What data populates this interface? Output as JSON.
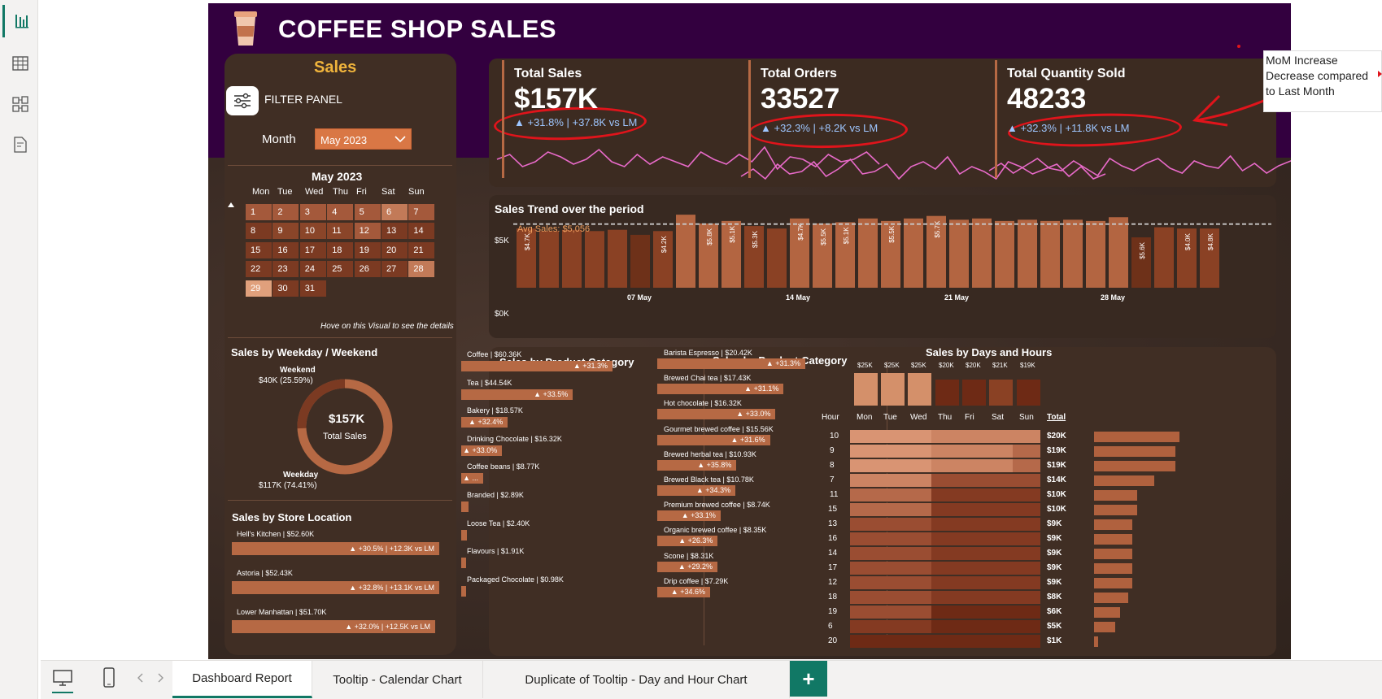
{
  "header": {
    "title": "COFFEE SHOP SALES"
  },
  "filter": {
    "section_title": "Sales",
    "panel_label": "FILTER PANEL",
    "month_label": "Month",
    "month_value": "May 2023",
    "calendar_title": "May 2023",
    "weekdays": [
      "Mon",
      "Tue",
      "Wed",
      "Thu",
      "Fri",
      "Sat",
      "Sun"
    ],
    "days": [
      "1",
      "2",
      "3",
      "4",
      "5",
      "6",
      "7",
      "8",
      "9",
      "10",
      "11",
      "12",
      "13",
      "14",
      "15",
      "16",
      "17",
      "18",
      "19",
      "20",
      "21",
      "22",
      "23",
      "24",
      "25",
      "26",
      "27",
      "28",
      "29",
      "30",
      "31"
    ],
    "hint": "Hove on this Visual to see the details"
  },
  "weekday": {
    "title": "Sales by Weekday / Weekend",
    "weekend_label": "Weekend",
    "weekend_value": "$40K (25.59%)",
    "weekday_label": "Weekday",
    "weekday_value": "$117K (74.41%)",
    "center_value": "$157K",
    "center_label": "Total Sales"
  },
  "store": {
    "title": "Sales by Store Location",
    "items": [
      {
        "label": "Hell's Kitchen | $52.60K",
        "delta": "▲ +30.5% | +12.3K vs LM"
      },
      {
        "label": "Astoria | $52.43K",
        "delta": "▲ +32.8% | +13.1K vs LM"
      },
      {
        "label": "Lower Manhattan | $51.70K",
        "delta": "▲ +32.0% | +12.5K vs LM"
      }
    ]
  },
  "kpis": [
    {
      "title": "Total Sales",
      "value": "$157K",
      "delta": "▲ +31.8% | +37.8K vs LM"
    },
    {
      "title": "Total Orders",
      "value": "33527",
      "delta": "▲ +32.3% | +8.2K vs LM"
    },
    {
      "title": "Total Quantity Sold",
      "value": "48233",
      "delta": "▲ +32.3% | +11.8K vs LM"
    }
  ],
  "trend": {
    "title": "Sales Trend over the period",
    "avg_label": "Avg Sales: $5,056",
    "ytick_top": "$5K",
    "ytick_bottom": "$0K",
    "xticks": [
      "07 May",
      "14 May",
      "21 May",
      "28 May"
    ],
    "bar_labels": [
      "$4.7K",
      "",
      "",
      "",
      "",
      "",
      "$4.2K",
      "",
      "$5.8K",
      "$5.1K",
      "$5.3K",
      "",
      "$4.7K",
      "$5.5K",
      "$5.1K",
      "",
      "$5.5K",
      "",
      "$5.7K",
      "",
      "",
      "",
      "",
      "",
      "",
      "",
      "",
      "$5.6K",
      "",
      "$4.0K",
      "$4.8K",
      "$4.7K"
    ]
  },
  "cat1": {
    "title": "Sales by Product Category",
    "items": [
      {
        "label": "Coffee | $60.36K",
        "delta": "▲ +31.3%"
      },
      {
        "label": "Tea | $44.54K",
        "delta": "▲ +33.5%"
      },
      {
        "label": "Bakery | $18.57K",
        "delta": "▲ +32.4%"
      },
      {
        "label": "Drinking Chocolate | $16.32K",
        "delta": "▲ +33.0%"
      },
      {
        "label": "Coffee beans | $8.77K",
        "delta": "▲ ..."
      },
      {
        "label": "Branded | $2.89K",
        "delta": ""
      },
      {
        "label": "Loose Tea | $2.40K",
        "delta": ""
      },
      {
        "label": "Flavours | $1.91K",
        "delta": ""
      },
      {
        "label": "Packaged Chocolate | $0.98K",
        "delta": ""
      }
    ]
  },
  "cat2": {
    "title": "Sales by Product Category",
    "items": [
      {
        "label": "Barista Espresso | $20.42K",
        "delta": "▲ +31.3%"
      },
      {
        "label": "Brewed Chai tea | $17.43K",
        "delta": "▲ +31.1%"
      },
      {
        "label": "Hot chocolate | $16.32K",
        "delta": "▲ +33.0%"
      },
      {
        "label": "Gourmet brewed coffee | $15.56K",
        "delta": "▲ +31.6%"
      },
      {
        "label": "Brewed herbal tea | $10.93K",
        "delta": "▲ +35.8%"
      },
      {
        "label": "Brewed Black tea | $10.78K",
        "delta": "▲ +34.3%"
      },
      {
        "label": "Premium brewed coffee | $8.74K",
        "delta": "▲ +33.1%"
      },
      {
        "label": "Organic brewed coffee | $8.35K",
        "delta": "▲ +26.3%"
      },
      {
        "label": "Scone | $8.31K",
        "delta": "▲ +29.2%"
      },
      {
        "label": "Drip coffee | $7.29K",
        "delta": "▲ +34.6%"
      }
    ]
  },
  "heat": {
    "title": "Sales by Days and Hours",
    "day_totals": [
      "$25K",
      "$25K",
      "$25K",
      "$20K",
      "$20K",
      "$21K",
      "$19K"
    ],
    "hour_header": "Hour",
    "days": [
      "Mon",
      "Tue",
      "Wed",
      "Thu",
      "Fri",
      "Sat",
      "Sun"
    ],
    "total_header": "Total",
    "hours": [
      "10",
      "9",
      "8",
      "7",
      "11",
      "15",
      "13",
      "16",
      "14",
      "17",
      "12",
      "18",
      "19",
      "6",
      "20"
    ],
    "totals": [
      "$20K",
      "$19K",
      "$19K",
      "$14K",
      "$10K",
      "$10K",
      "$9K",
      "$9K",
      "$9K",
      "$9K",
      "$9K",
      "$8K",
      "$6K",
      "$5K",
      "$1K"
    ]
  },
  "annotation": {
    "text": "MoM Increase Decrease compared to Last Month"
  },
  "tabs": {
    "items": [
      "Dashboard Report",
      "Tooltip - Calendar Chart",
      "Duplicate of Tooltip - Day and Hour Chart"
    ],
    "add": "+"
  },
  "chart_data": [
    {
      "type": "bar",
      "title": "Sales Trend over the period",
      "categories": [
        "1",
        "2",
        "3",
        "4",
        "5",
        "6",
        "7",
        "8",
        "9",
        "10",
        "11",
        "12",
        "13",
        "14",
        "15",
        "16",
        "17",
        "18",
        "19",
        "20",
        "21",
        "22",
        "23",
        "24",
        "25",
        "26",
        "27",
        "28",
        "29",
        "30",
        "31"
      ],
      "values": [
        4.7,
        4.5,
        4.6,
        4.5,
        4.6,
        4.2,
        4.5,
        5.8,
        5.1,
        5.3,
        4.9,
        4.7,
        5.5,
        5.1,
        5.2,
        5.5,
        5.3,
        5.5,
        5.7,
        5.4,
        5.5,
        5.3,
        5.4,
        5.3,
        5.4,
        5.3,
        5.6,
        4.0,
        4.8,
        4.7,
        4.7
      ],
      "ylim": [
        0,
        6
      ],
      "average": 5.056,
      "ylabel": ""
    },
    {
      "type": "bar",
      "title": "Sales by Product Category",
      "categories": [
        "Coffee",
        "Tea",
        "Bakery",
        "Drinking Chocolate",
        "Coffee beans",
        "Branded",
        "Loose Tea",
        "Flavours",
        "Packaged Chocolate"
      ],
      "values": [
        60.36,
        44.54,
        18.57,
        16.32,
        8.77,
        2.89,
        2.4,
        1.91,
        0.98
      ]
    },
    {
      "type": "bar",
      "title": "Sales by Product Category",
      "categories": [
        "Barista Espresso",
        "Brewed Chai tea",
        "Hot chocolate",
        "Gourmet brewed coffee",
        "Brewed herbal tea",
        "Brewed Black tea",
        "Premium brewed coffee",
        "Organic brewed coffee",
        "Scone",
        "Drip coffee"
      ],
      "values": [
        20.42,
        17.43,
        16.32,
        15.56,
        10.93,
        10.78,
        8.74,
        8.35,
        8.31,
        7.29
      ]
    },
    {
      "type": "pie",
      "title": "Sales by Weekday / Weekend",
      "categories": [
        "Weekday",
        "Weekend"
      ],
      "values": [
        74.41,
        25.59
      ]
    },
    {
      "type": "heatmap",
      "title": "Sales by Days and Hours",
      "x": [
        "Mon",
        "Tue",
        "Wed",
        "Thu",
        "Fri",
        "Sat",
        "Sun"
      ],
      "y": [
        "10",
        "9",
        "8",
        "7",
        "11",
        "15",
        "13",
        "16",
        "14",
        "17",
        "12",
        "18",
        "19",
        "6",
        "20"
      ],
      "day_totals_k": [
        25,
        25,
        25,
        20,
        20,
        21,
        19
      ],
      "hour_totals_k": [
        20,
        19,
        19,
        14,
        10,
        10,
        9,
        9,
        9,
        9,
        9,
        8,
        6,
        5,
        1
      ]
    }
  ],
  "colors": {
    "header": "#33003f",
    "panel": "#402e24",
    "bar": "#b66944",
    "accent_tab": "#117865"
  }
}
